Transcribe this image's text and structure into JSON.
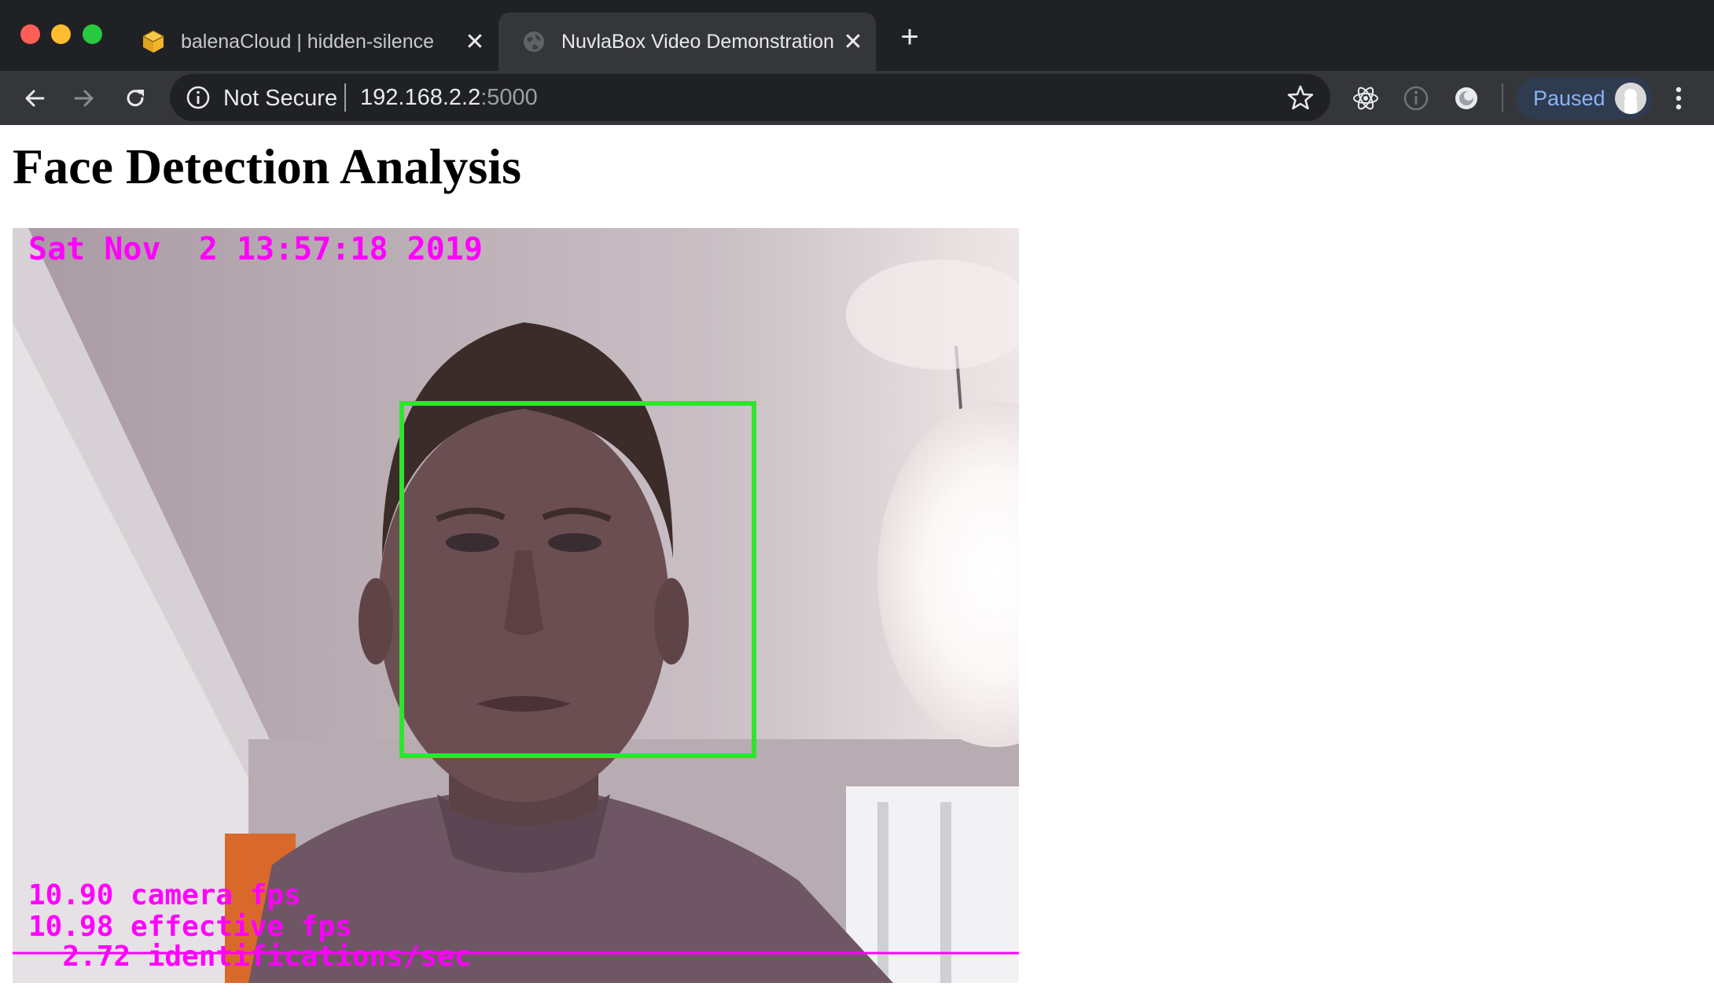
{
  "browser": {
    "tabs": [
      {
        "title": "balenaCloud | hidden-silence",
        "favicon": "cube-icon",
        "active": false
      },
      {
        "title": "NuvlaBox Video Demonstration",
        "favicon": "globe-icon",
        "active": true
      }
    ],
    "address": {
      "security_label": "Not Secure",
      "host": "192.168.2.2",
      "port": ":5000"
    },
    "profile_status": "Paused"
  },
  "page": {
    "title": "Face Detection Analysis",
    "video_overlay": {
      "timestamp": "Sat Nov  2 13:57:18 2019",
      "camera_fps": "10.90 camera fps",
      "effective_fps": "10.98 effective fps",
      "identifications": "  2.72 identifications/sec",
      "face_box_color": "#2ee52e",
      "overlay_color": "#ff00ff"
    }
  }
}
